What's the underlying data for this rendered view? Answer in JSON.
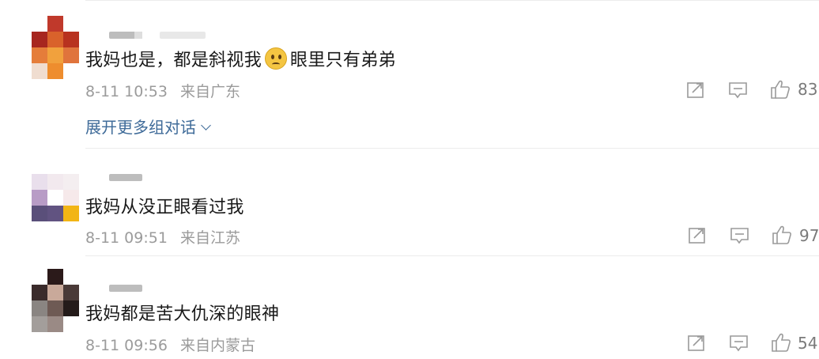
{
  "comments": [
    {
      "text_before": "我妈也是，都是斜视我",
      "emoji": "eye-roll-emoji",
      "text_after": "眼里只有弟弟",
      "date": "8-11",
      "time": "10:53",
      "location": "来自广东",
      "likes": "83",
      "expand_label": "展开更多组对话"
    },
    {
      "text": "我妈从没正眼看过我",
      "date": "8-11",
      "time": "09:51",
      "location": "来自江苏",
      "likes": "97"
    },
    {
      "text": "我妈都是苦大仇深的眼神",
      "date": "8-11",
      "time": "09:56",
      "location": "来自内蒙古",
      "likes": "54"
    }
  ],
  "icons": {
    "share": "share-icon",
    "reply": "comment-icon",
    "like": "thumbs-up-icon"
  },
  "colors": {
    "link": "#3f6b99",
    "meta": "#9b9b9b",
    "text": "#1a1a1a",
    "divider": "#ececec"
  }
}
